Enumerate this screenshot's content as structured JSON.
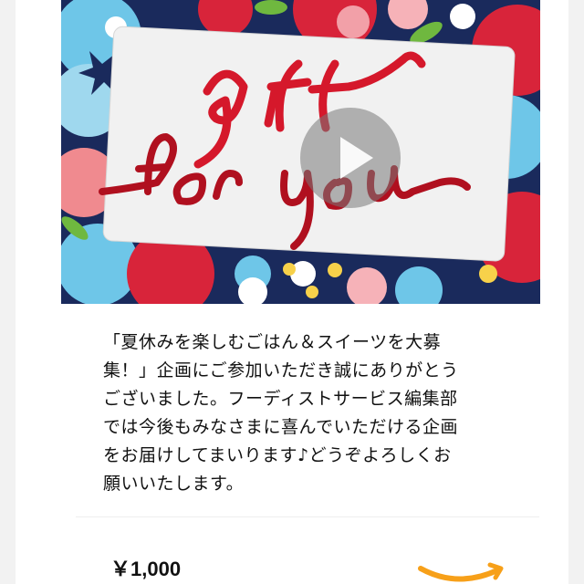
{
  "gift_card": {
    "script_line1": "gift",
    "script_line2": "for you"
  },
  "video": {
    "play_icon": "play-icon"
  },
  "message": {
    "text": "「夏休みを楽しむごはん＆スイーツを大募\n集！」企画にご参加いただき誠にありがとう\nございました。フーディストサービス編集部\nでは今後もみなさまに喜んでいただける企画\nをお届けしてまいります♪どうぞよろしくお\n願いいたします。"
  },
  "product": {
    "price": "￥1,000",
    "logo_icon": "amazon-smile-icon"
  },
  "colors": {
    "ribbon_red": "#d5182b",
    "floral_navy": "#1a2a5c",
    "amazon_orange": "#f7a019"
  }
}
